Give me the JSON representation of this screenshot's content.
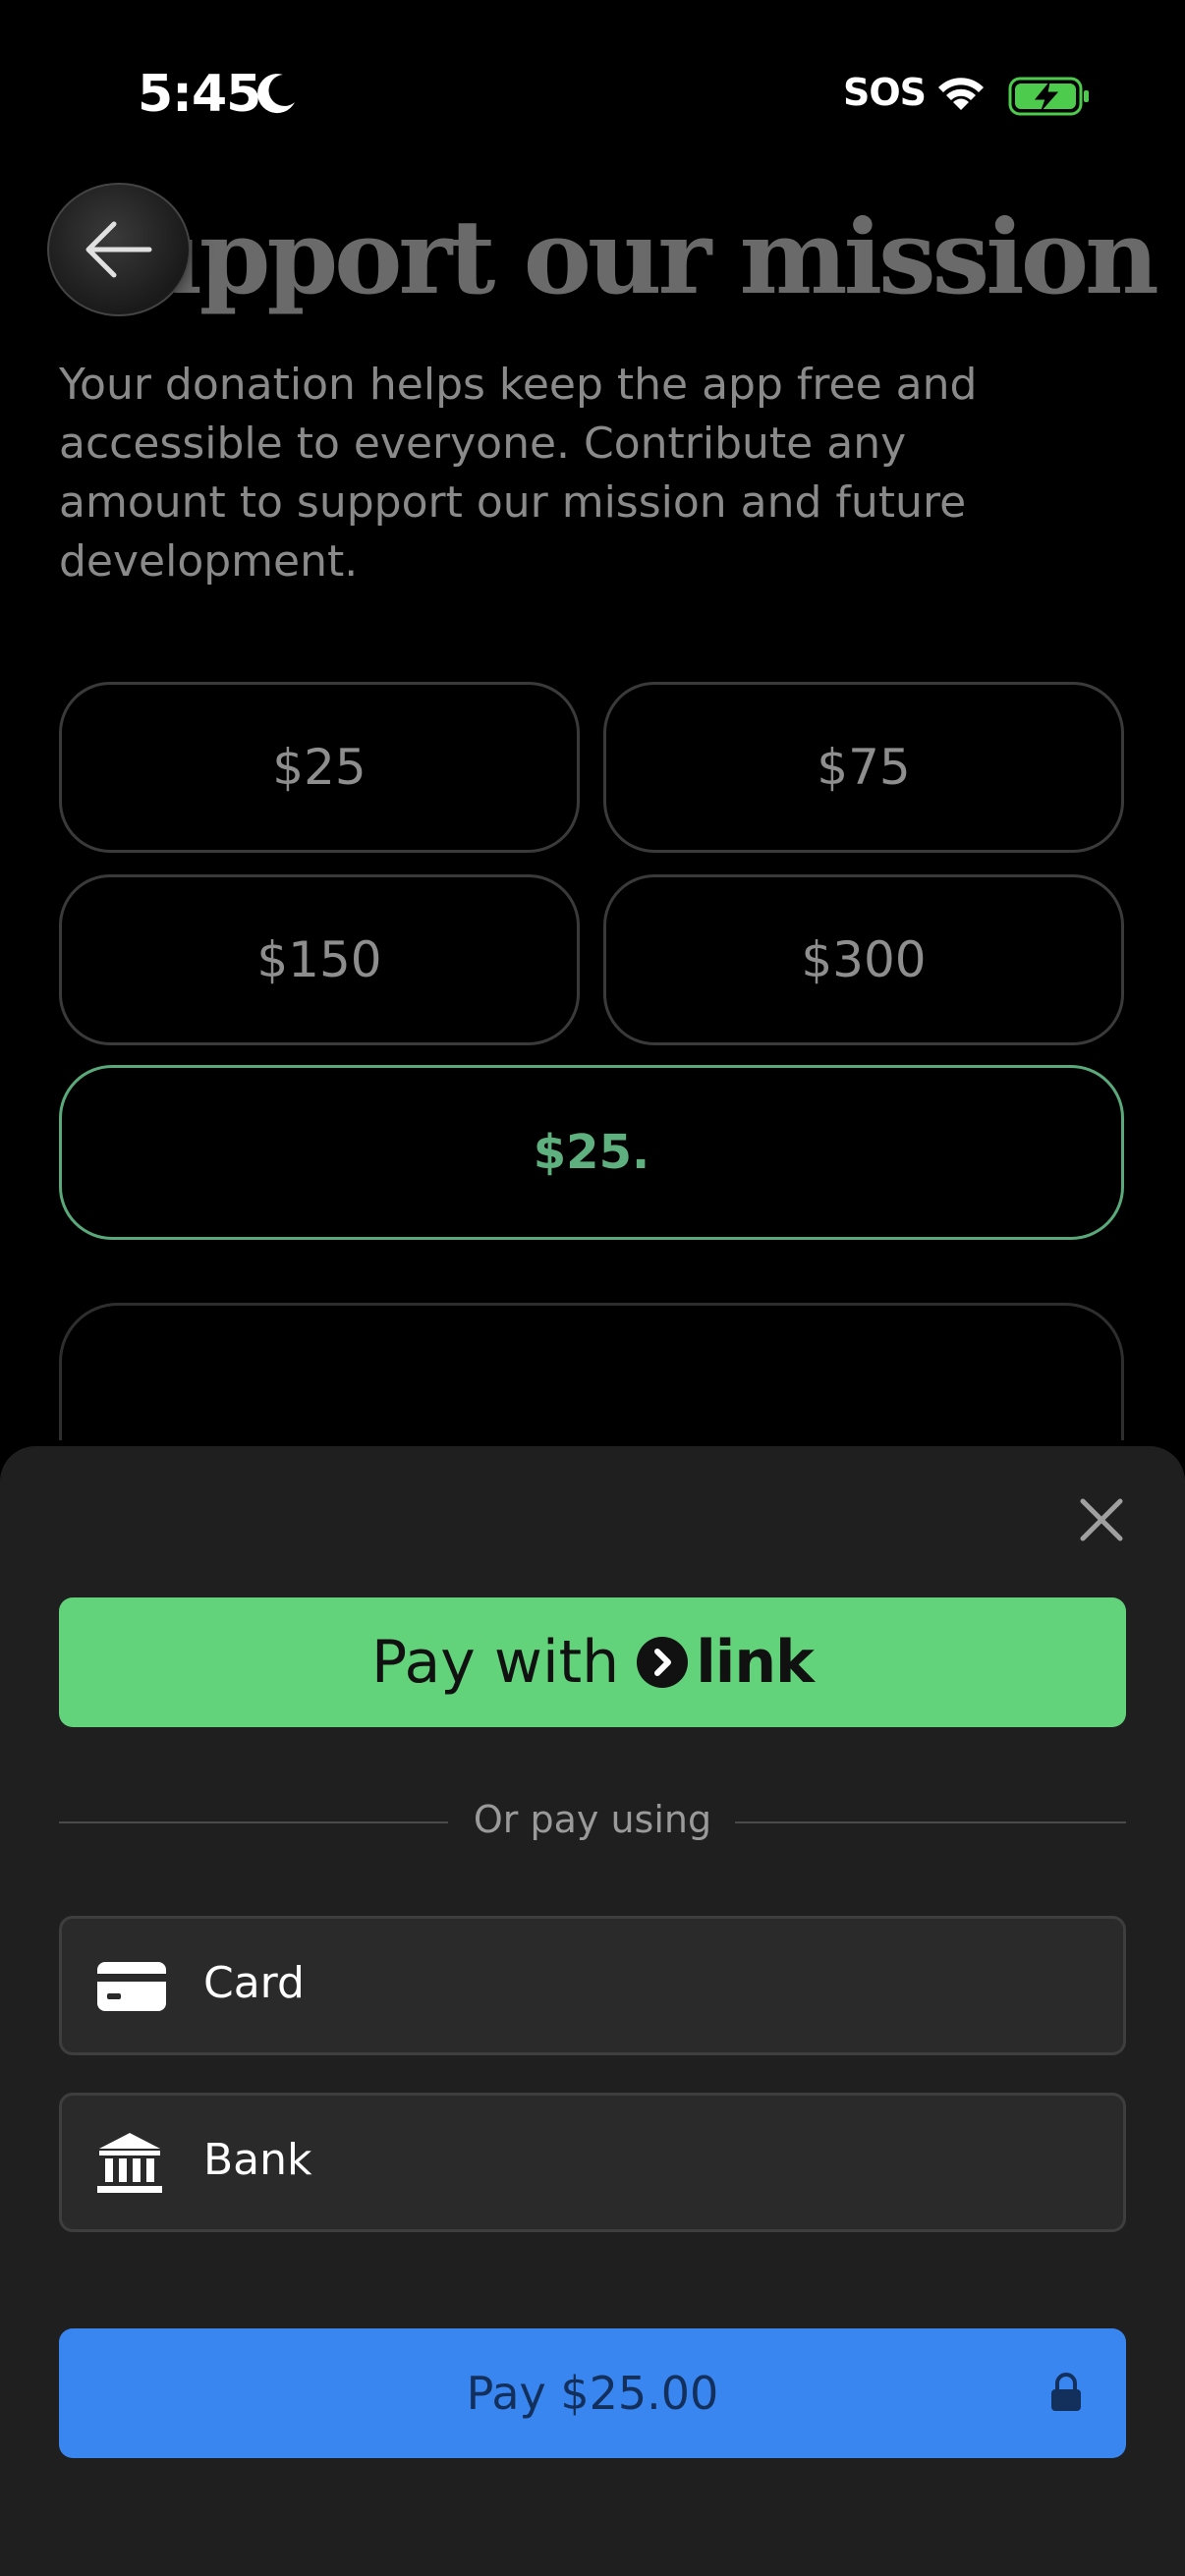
{
  "status_bar": {
    "time": "5:45",
    "carrier": "SOS"
  },
  "page": {
    "title": "Support our mission",
    "description": "Your donation helps keep the app free and accessible to everyone. Contribute any amount to support our mission and future development.",
    "amounts": [
      "$25",
      "$75",
      "$150",
      "$300"
    ],
    "custom_amount": "$25."
  },
  "sheet": {
    "link_button": {
      "prefix": "Pay with",
      "brand": "link"
    },
    "divider_text": "Or pay using",
    "methods": [
      {
        "label": "Card",
        "icon": "card-icon"
      },
      {
        "label": "Bank",
        "icon": "bank-icon"
      }
    ],
    "pay_button": "Pay $25.00"
  },
  "colors": {
    "accent_green": "#62d37b",
    "selected_border": "#5aa97a",
    "pay_blue": "#3a86f0",
    "sheet_bg": "#1f1f1f"
  }
}
